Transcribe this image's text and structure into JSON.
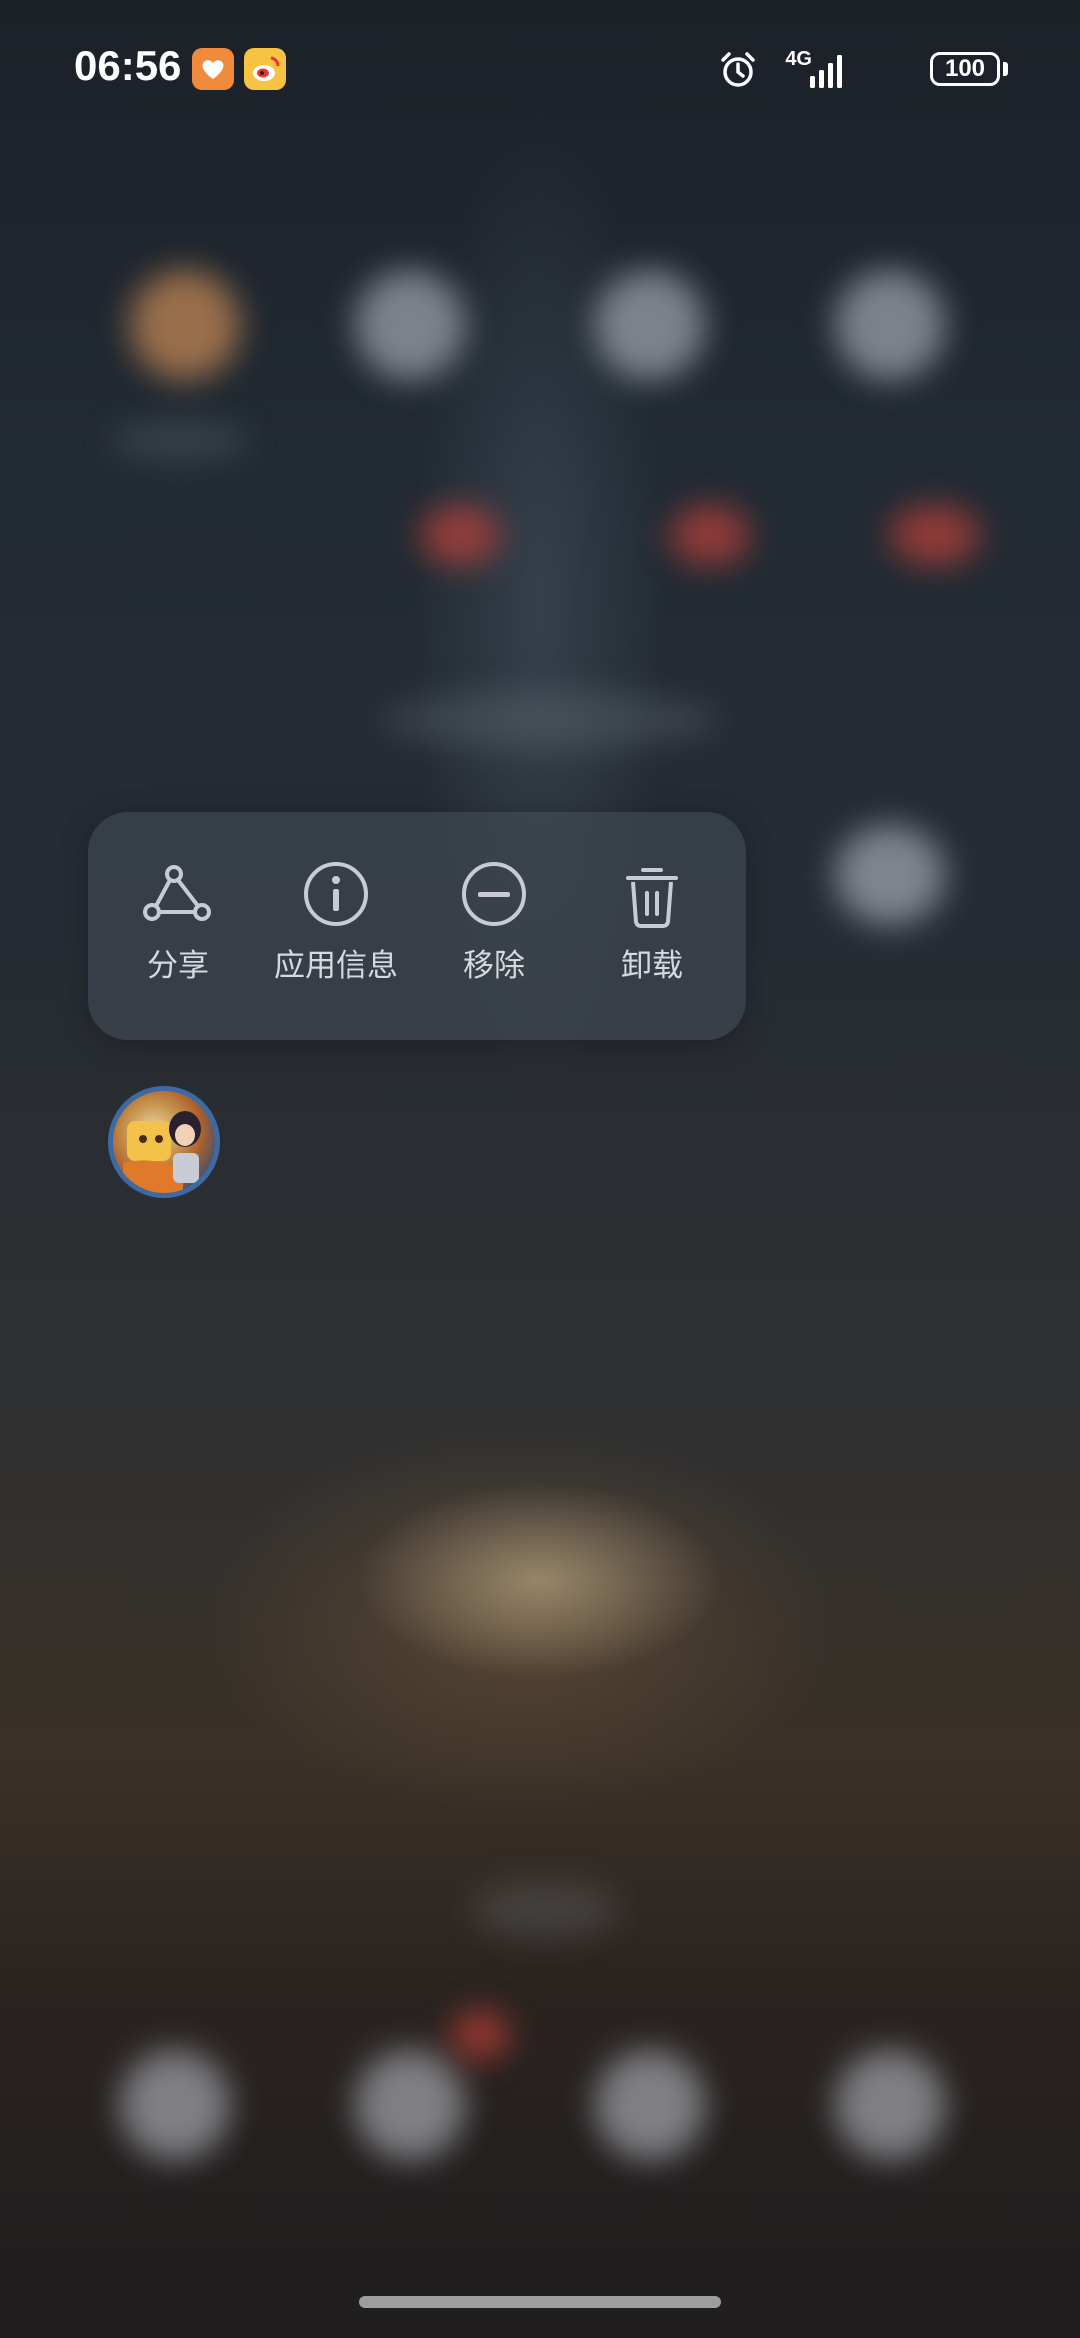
{
  "status_bar": {
    "time": "06:56",
    "notification_icons": [
      "health-app-icon",
      "weibo-app-icon"
    ],
    "network_label": "4G",
    "battery_level": "100",
    "icons": [
      "alarm-icon",
      "signal-icon",
      "battery-icon"
    ]
  },
  "context_menu": {
    "items": [
      {
        "label": "分享",
        "icon": "share-icon"
      },
      {
        "label": "应用信息",
        "icon": "info-icon"
      },
      {
        "label": "移除",
        "icon": "remove-icon"
      },
      {
        "label": "卸载",
        "icon": "trash-icon"
      }
    ]
  },
  "selected_app": {
    "icon": "game-app-icon"
  },
  "colors": {
    "menu_text": "#d6d9de",
    "app_icon_border": "#3e6aa3",
    "health_app": "#f08a3c",
    "weibo_app": "#f6c343"
  }
}
